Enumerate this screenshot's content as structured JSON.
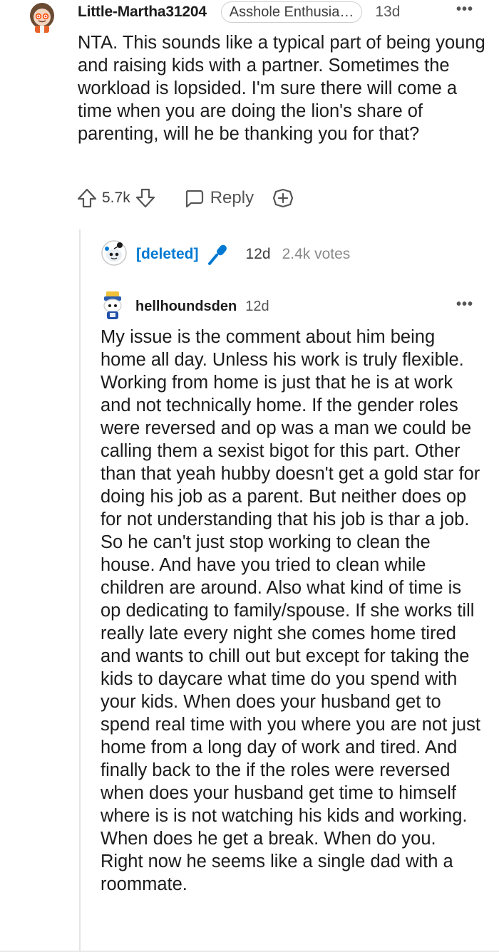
{
  "comment1": {
    "username": "Little-Martha31204",
    "flair": "Asshole Enthusia…",
    "time": "13d",
    "more": "•••",
    "body": "NTA. This sounds like a typical part of being young and raising kids with a partner. Sometimes the workload is lopsided. I'm sure there will come a time when you are doing the lion's share of parenting, will he be thanking you for that?",
    "vote_count": "5.7k",
    "reply_label": "Reply"
  },
  "comment2": {
    "username": "[deleted]",
    "time": "12d",
    "votes": "2.4k votes"
  },
  "comment3": {
    "username": "hellhoundsden",
    "time": "12d",
    "more": "•••",
    "body": "My issue is the comment about him being home all day. Unless his work is truly flexible. Working from home is just that he is at work and not technically home. If the gender roles were reversed and op was a man we could be calling them a sexist bigot for this part. Other than that yeah hubby doesn't get a gold star for doing his job as a parent. But neither does op for not understanding that his job is thar a job. So he can't just stop working to clean the house. And have you tried to clean while children are around. Also what kind of time is op dedicating to family/spouse. If she works till really late every night she comes home tired and wants to chill out but except for taking the kids to daycare what time do you spend with your kids. When does your husband get to spend real time with you where you are not just home from a long day of work and tired. And finally back to the if the roles were reversed when does your husband get time to himself where is is not watching his kids and working. When does he get a break. When do you. Right now he seems like a single dad with a roommate."
  },
  "icons": {
    "upvote": "upvote-arrow-icon",
    "downvote": "downvote-arrow-icon",
    "reply": "chat-bubble-icon",
    "award": "add-award-icon",
    "mic": "microphone-icon"
  },
  "colors": {
    "deleted_user": "#0079d3",
    "mic": "#0079d3",
    "thread_line": "#e4e4e4"
  }
}
